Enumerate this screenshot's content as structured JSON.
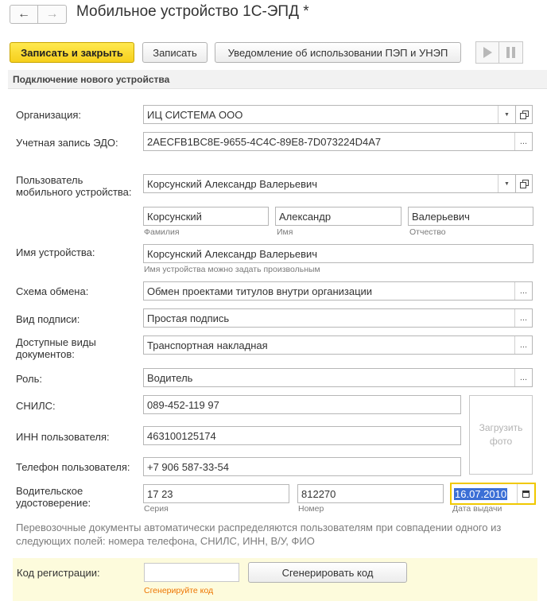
{
  "window": {
    "back_icon": "arrow-left-icon",
    "forward_icon": "arrow-right-icon",
    "back_glyph": "←",
    "forward_glyph": "→",
    "title": "Мобильное устройство 1С-ЭПД *"
  },
  "toolbar": {
    "save_close_label": "Записать и закрыть",
    "save_label": "Записать",
    "notice_label": "Уведомление об использовании ПЭП и УНЭП",
    "play_icon": "play-icon",
    "pause_icon": "pause-icon"
  },
  "section": {
    "title": "Подключение нового устройства"
  },
  "form": {
    "organization": {
      "label": "Организация:",
      "value": "ИЦ СИСТЕМА ООО"
    },
    "edo_account": {
      "label": "Учетная запись ЭДО:",
      "value": "2AECFB1BC8E-9655-4C4C-89E8-7D073224D4A7"
    },
    "user": {
      "label_line1": "Пользователь",
      "label_line2": "мобильного устройства:",
      "value": "Корсунский Александр Валерьевич",
      "last_name": {
        "value": "Корсунский",
        "hint": "Фамилия"
      },
      "first_name": {
        "value": "Александр",
        "hint": "Имя"
      },
      "middle_name": {
        "value": "Валерьевич",
        "hint": "Отчество"
      }
    },
    "device_name": {
      "label": "Имя устройства:",
      "value": "Корсунский Александр Валерьевич",
      "hint": "Имя устройства можно задать произвольным"
    },
    "exchange_scheme": {
      "label": "Схема обмена:",
      "value": "Обмен проектами титулов внутри организации"
    },
    "signature_type": {
      "label": "Вид подписи:",
      "value": "Простая подпись"
    },
    "doc_types": {
      "label_line1": "Доступные виды",
      "label_line2": "документов:",
      "value": "Транспортная накладная"
    },
    "role": {
      "label": "Роль:",
      "value": "Водитель"
    },
    "snils": {
      "label": "СНИЛС:",
      "value": "089-452-119 97"
    },
    "inn": {
      "label": "ИНН пользователя:",
      "value": "463100125174"
    },
    "phone": {
      "label": "Телефон пользователя:",
      "value": "+7 906 587-33-54"
    },
    "photo": {
      "line1": "Загрузить",
      "line2": "фото"
    },
    "license": {
      "label_line1": "Водительское",
      "label_line2": "удостоверение:",
      "series": {
        "value": "17 23",
        "hint": "Серия"
      },
      "number": {
        "value": "812270",
        "hint": "Номер"
      },
      "issue_date": {
        "value": "16.07.2010",
        "hint": "Дата выдачи"
      }
    },
    "info_text": "Перевозочные документы автоматически распределяются пользователям при совпадении одного из следующих полей: номера телефона, СНИЛС, ИНН, В/У, ФИО"
  },
  "registration": {
    "label": "Код регистрации:",
    "value": "",
    "hint": "Сгенерируйте код",
    "generate_label": "Сгенерировать код"
  },
  "icons": {
    "dropdown": "chevron-down-icon",
    "dropdown_glyph": "▼",
    "open_form": "copy-icon",
    "select_dots": "ellipsis-icon",
    "dots_glyph": "...",
    "calendar": "calendar-icon"
  },
  "colors": {
    "primary_button": "#f6cf1c",
    "date_focus_border": "#f0c800",
    "selection": "#3b6fd6",
    "hint_warning": "#ee7400",
    "registration_bg": "#fdfbdc"
  }
}
